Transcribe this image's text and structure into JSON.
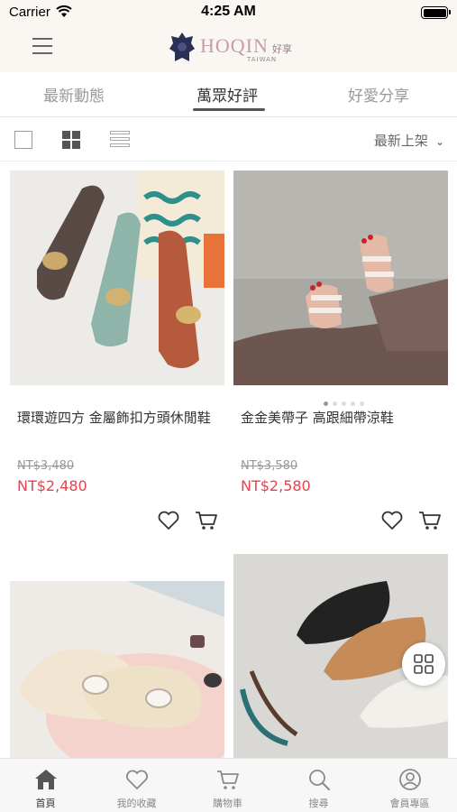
{
  "status": {
    "carrier": "Carrier",
    "time": "4:25 AM"
  },
  "header": {
    "brand": "HOQIN",
    "brand_sub": "TAIWAN",
    "brand_cn": "好享"
  },
  "tabs": [
    {
      "label": "最新動態",
      "active": false
    },
    {
      "label": "萬眾好評",
      "active": true
    },
    {
      "label": "好愛分享",
      "active": false
    }
  ],
  "view": {
    "sort_label": "最新上架"
  },
  "products": [
    {
      "title": "環環遊四方 金屬飾扣方頭休閒鞋",
      "original_price": "NT$3,480",
      "price": "NT$2,480"
    },
    {
      "title": "金金美帶子 高跟細帶涼鞋",
      "original_price": "NT$3,580",
      "price": "NT$2,580"
    }
  ],
  "bottom_nav": [
    {
      "label": "首頁",
      "icon": "home-icon",
      "active": true
    },
    {
      "label": "我的收藏",
      "icon": "heart-icon",
      "active": false
    },
    {
      "label": "購物車",
      "icon": "cart-icon",
      "active": false
    },
    {
      "label": "搜尋",
      "icon": "search-icon",
      "active": false
    },
    {
      "label": "會員專區",
      "icon": "user-icon",
      "active": false
    }
  ],
  "colors": {
    "accent_price": "#e8424c",
    "brand": "#c79ba9",
    "header_bg": "#faf7f3"
  }
}
